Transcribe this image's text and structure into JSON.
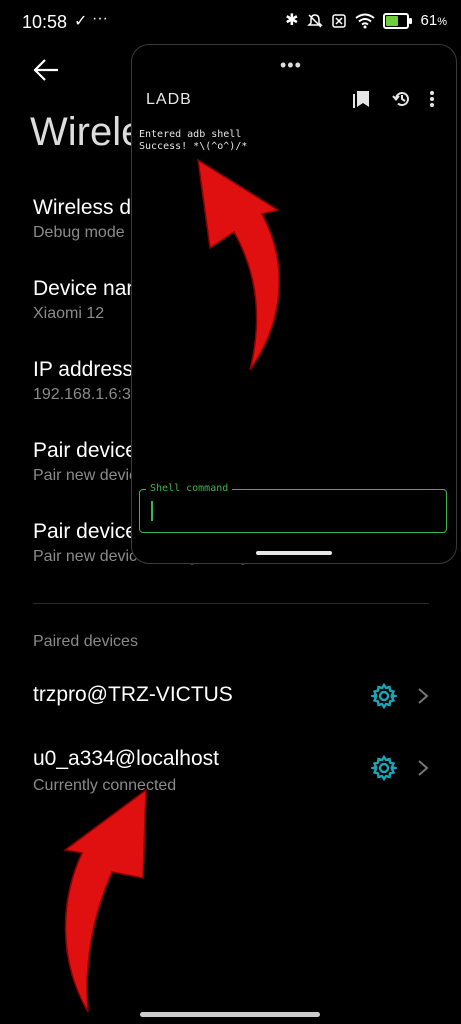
{
  "status_bar": {
    "time": "10:58",
    "battery_percent": "61",
    "battery_suffix": "%",
    "check_icon": "✓",
    "dots": "···",
    "bluetooth_icon": "✱",
    "mute_icon": "🔕",
    "battery_fill_color": "#6fcf3a"
  },
  "background_page": {
    "title": "Wirele",
    "rows": [
      {
        "title": "Wireless d",
        "subtitle": "Debug mode"
      },
      {
        "title": "Device nar",
        "subtitle": "Xiaomi 12"
      },
      {
        "title": "IP address",
        "subtitle": "192.168.1.6:3"
      },
      {
        "title": "Pair device",
        "subtitle": "Pair new devic"
      },
      {
        "title": "Pair device",
        "subtitle": "Pair new devices using six-digit code"
      }
    ],
    "section_label": "Paired devices",
    "paired_devices": [
      {
        "name": "trzpro@TRZ-VICTUS",
        "status": ""
      },
      {
        "name": "u0_a334@localhost",
        "status": "Currently connected"
      }
    ],
    "accent_color": "#1aa6b7"
  },
  "floating_window": {
    "handle": "•••",
    "app_title": "LADB",
    "terminal_lines": [
      "Entered adb shell",
      "Success! *\\(^o^)/*"
    ],
    "shell_label": "Shell command",
    "input_value": "",
    "border_color": "#3bb54a"
  },
  "annotations": {
    "arrow_color": "#e01010"
  }
}
